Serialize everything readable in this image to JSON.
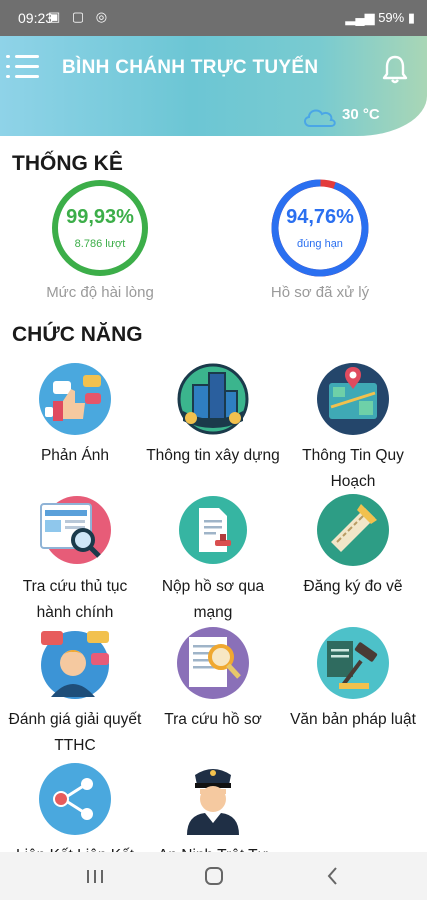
{
  "status_bar": {
    "time": "09:23",
    "battery": "59%"
  },
  "header": {
    "title": "BÌNH CHÁNH TRỰC TUYẾN",
    "temperature": "30 °C"
  },
  "stats": {
    "title": "THỐNG KÊ",
    "satisfaction": {
      "value": "99,93%",
      "sub": "8.786 lượt",
      "caption": "Mức độ hài lòng",
      "percent": 99.93,
      "color": "#3cae49"
    },
    "processed": {
      "value": "94,76%",
      "sub": "đúng hạn",
      "caption": "Hồ sơ đã xử lý",
      "percent": 94.76,
      "color": "#2a6ff0",
      "remainder_color": "#e33b3b"
    }
  },
  "functions": {
    "title": "CHỨC NĂNG",
    "items": [
      {
        "label": "Phản Ánh",
        "icon": "feedback-icon"
      },
      {
        "label": "Thông tin xây dựng",
        "icon": "building-icon"
      },
      {
        "label": "Thông Tin Quy Hoạch",
        "icon": "planning-map-icon"
      },
      {
        "label": "Tra cứu thủ tục hành chính",
        "icon": "procedure-search-icon"
      },
      {
        "label": "Nộp hồ sơ qua mạng",
        "icon": "online-submit-icon"
      },
      {
        "label": "Đăng ký đo vẽ",
        "icon": "survey-ruler-icon"
      },
      {
        "label": "Đánh giá giải quyết TTHC",
        "icon": "rating-person-icon"
      },
      {
        "label": "Tra cứu hồ sơ",
        "icon": "document-search-icon"
      },
      {
        "label": "Văn bản pháp luật",
        "icon": "law-gavel-icon"
      },
      {
        "label": "Liên Kết Liên Kết",
        "icon": "share-icon"
      },
      {
        "label": "An Ninh Trật Tự",
        "icon": "police-officer-icon"
      }
    ]
  }
}
